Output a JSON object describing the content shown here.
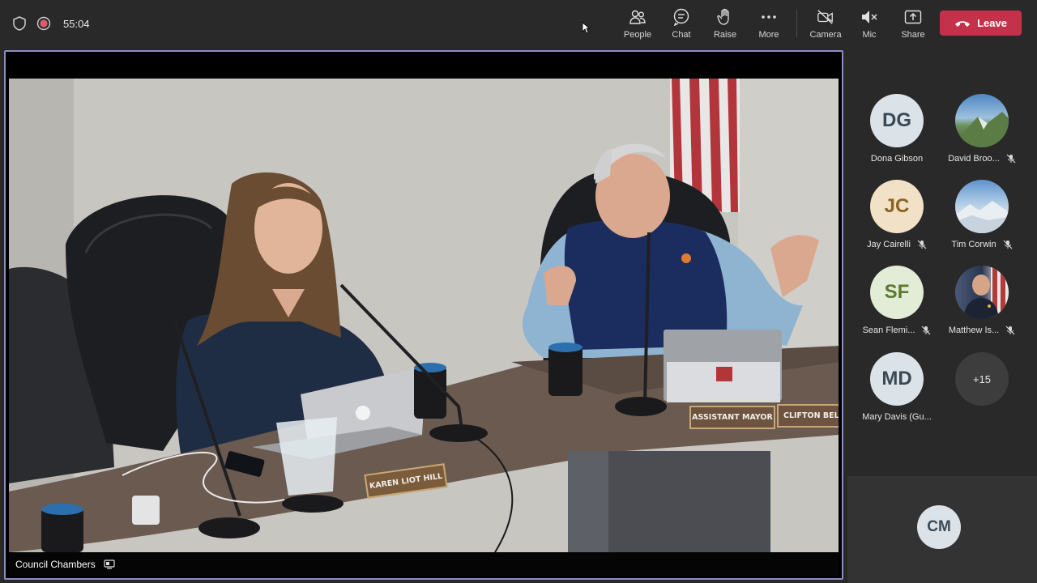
{
  "meeting": {
    "timer": "55:04"
  },
  "toolbar": {
    "people": "People",
    "chat": "Chat",
    "raise": "Raise",
    "more": "More",
    "camera": "Camera",
    "mic": "Mic",
    "share": "Share",
    "leave": "Leave"
  },
  "stage": {
    "label": "Council Chambers",
    "nameplates": {
      "left": "KAREN LIOT HILL",
      "center": "ASSISTANT MAYOR",
      "right": "CLIFTON BELC"
    }
  },
  "participants": [
    {
      "initials": "DG",
      "name": "Dona Gibson",
      "muted": false,
      "bg": "#dbe3e8",
      "fg": "#3a4a55",
      "photo": false
    },
    {
      "initials": "",
      "name": "David Broo...",
      "muted": true,
      "bg": "#5a86b3",
      "fg": "#ffffff",
      "photo": true
    },
    {
      "initials": "JC",
      "name": "Jay Cairelli",
      "muted": true,
      "bg": "#f1e1c6",
      "fg": "#8a6426",
      "photo": false
    },
    {
      "initials": "",
      "name": "Tim Corwin",
      "muted": true,
      "bg": "#7ea8d2",
      "fg": "#ffffff",
      "photo": true
    },
    {
      "initials": "SF",
      "name": "Sean Flemi...",
      "muted": true,
      "bg": "#e3ecd6",
      "fg": "#5b7a2e",
      "photo": false
    },
    {
      "initials": "",
      "name": "Matthew Is...",
      "muted": true,
      "bg": "#2f3a52",
      "fg": "#ffffff",
      "photo": true
    },
    {
      "initials": "MD",
      "name": "Mary Davis (Gu...",
      "muted": false,
      "bg": "#dbe3e8",
      "fg": "#3a4a55",
      "photo": false
    }
  ],
  "overflow": "+15",
  "self": {
    "initials": "CM"
  }
}
